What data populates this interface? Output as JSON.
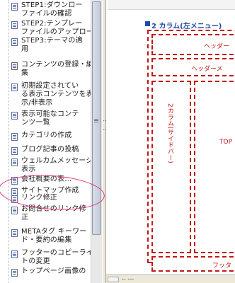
{
  "tree": {
    "items": [
      {
        "label": "STEP1:ダウンロー\nファイルの確認",
        "icon": "document-icon"
      },
      {
        "label": "STEP2:テンプレー\nファイルのアップロード",
        "icon": "document-icon"
      },
      {
        "label": "STEP3:テーマの適\n用",
        "icon": "document-icon"
      },
      {
        "label": "コンテンツの登録・編\n集",
        "icon": "document-open-icon"
      },
      {
        "label": "初期設定されてい\nる表示コンテンツを表\n示/非表示",
        "icon": "document-icon"
      },
      {
        "label": "表示可能なコンテ\nンツ一覧",
        "icon": "document-icon"
      },
      {
        "label": "カテゴリの作成",
        "icon": "document-icon"
      },
      {
        "label": "ブログ記事の投稿",
        "icon": "document-icon"
      },
      {
        "label": "ウェルカムメッセージの\n表示",
        "icon": "document-icon"
      },
      {
        "label": "会社概要の表...",
        "icon": "document-icon"
      },
      {
        "label": "サイトマップ作成",
        "icon": "document-icon"
      },
      {
        "label": "リンク修正",
        "icon": "document-icon"
      },
      {
        "label": "お問合せのリンク修\n正",
        "icon": "document-icon"
      },
      {
        "label": "METAタグ キーワー\nド・要約の編集",
        "icon": "document-icon"
      },
      {
        "label": "フッターのコピーライ\nトの変更",
        "icon": "document-icon"
      },
      {
        "label": "トップページ画像の",
        "icon": "document-icon"
      }
    ]
  },
  "content": {
    "section_title": "2 カラム(左メニュー)",
    "diagram": {
      "header_label": "ヘッダー",
      "header_menu_label": "ヘッダーメ",
      "sidebar_label": "2カラム(サイドバー)",
      "main_label": "TOP",
      "footer_label": "フッタ"
    }
  },
  "status": {
    "text": "-- ---"
  },
  "colors": {
    "accent": "#1e4aa8",
    "diagram_red": "#c01818",
    "highlight": "#e0307a"
  }
}
